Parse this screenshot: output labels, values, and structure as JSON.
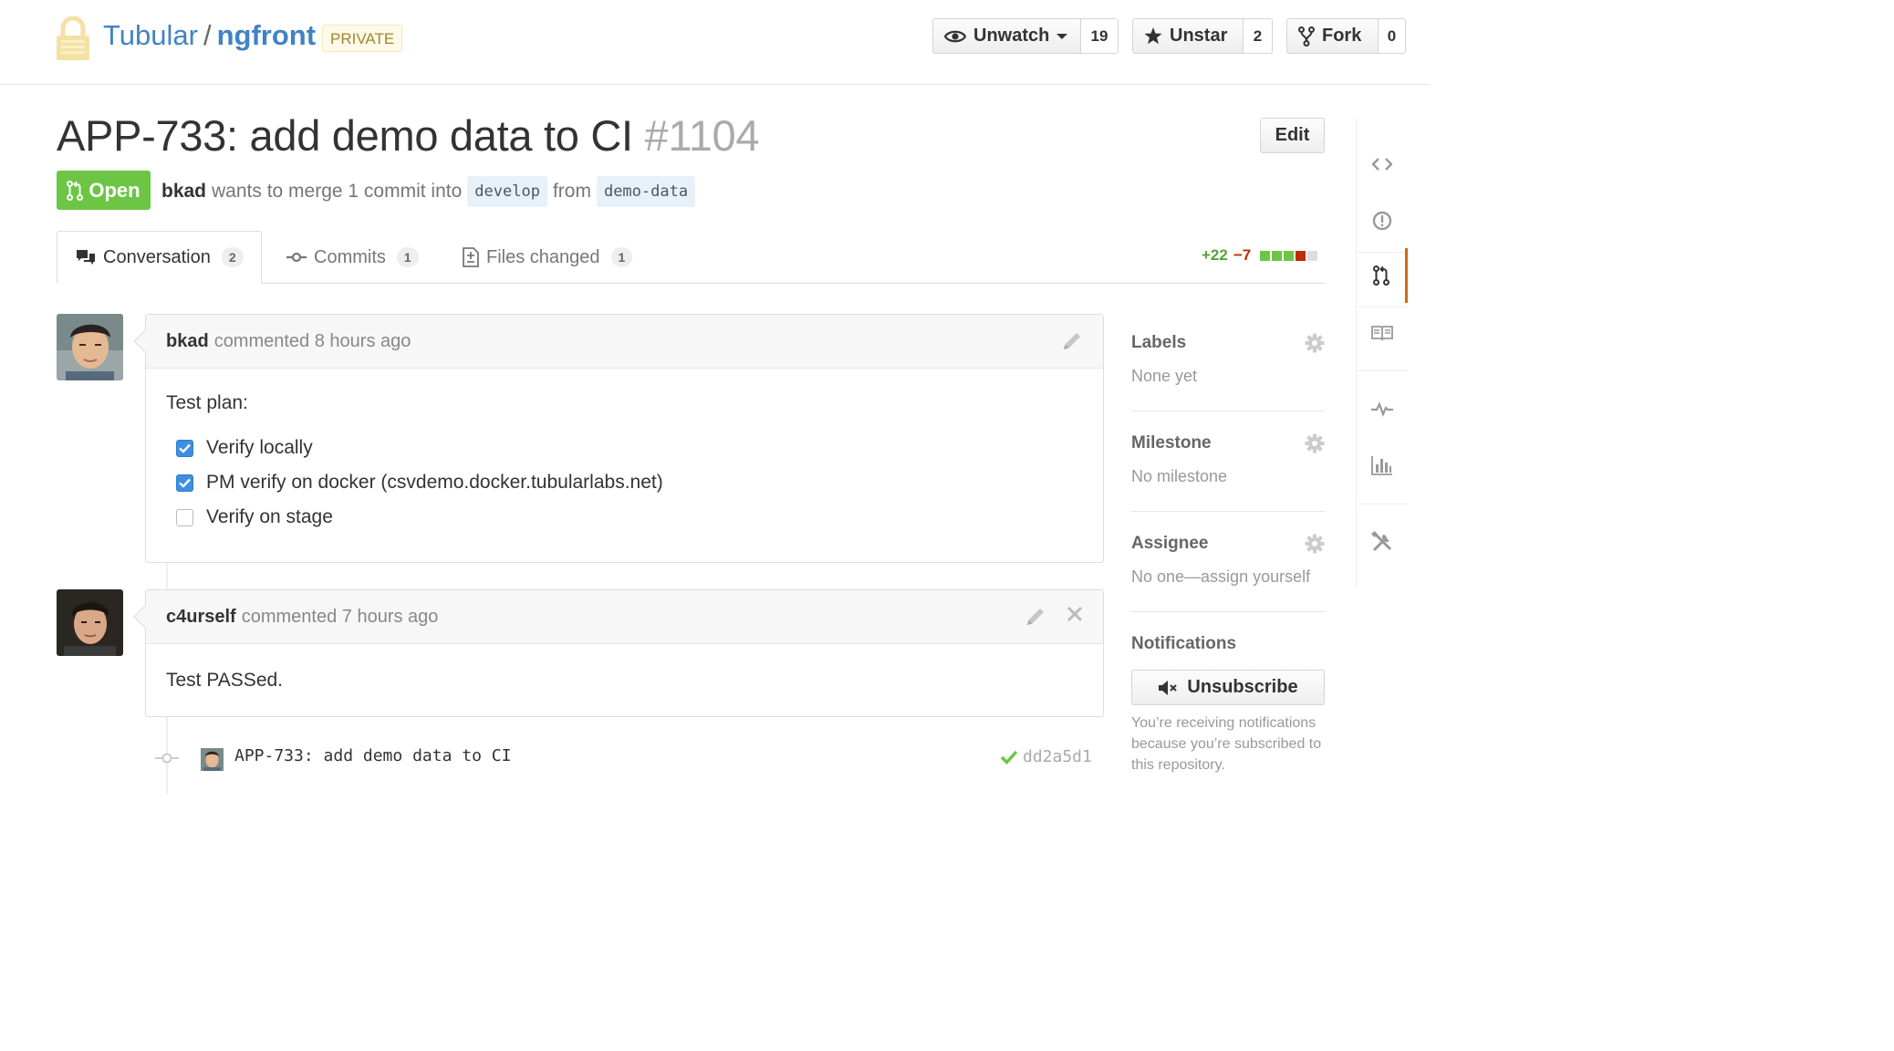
{
  "repo": {
    "owner": "Tubular",
    "separator": "/",
    "name": "ngfront",
    "visibility": "PRIVATE"
  },
  "actions": {
    "watch": {
      "label": "Unwatch",
      "count": "19"
    },
    "star": {
      "label": "Unstar",
      "count": "2"
    },
    "fork": {
      "label": "Fork",
      "count": "0"
    }
  },
  "pr": {
    "title": "APP-733: add demo data to CI",
    "number": "#1104",
    "edit_label": "Edit",
    "state": "Open",
    "author": "bkad",
    "merge_text": "wants to merge 1 commit into",
    "base_branch": "develop",
    "from_text": "from",
    "head_branch": "demo-data"
  },
  "tabs": [
    {
      "label": "Conversation",
      "count": "2"
    },
    {
      "label": "Commits",
      "count": "1"
    },
    {
      "label": "Files changed",
      "count": "1"
    }
  ],
  "diffstat": {
    "additions": "+22",
    "deletions": "−7",
    "blocks": [
      "#6cc644",
      "#6cc644",
      "#6cc644",
      "#bd2c00",
      "#dddddd"
    ]
  },
  "comments": [
    {
      "author": "bkad",
      "action": "commented 8 hours ago",
      "body_heading": "Test plan:",
      "tasks": [
        {
          "text": "Verify locally",
          "checked": true
        },
        {
          "text": "PM verify on docker (csvdemo.docker.tubularlabs.net)",
          "checked": true
        },
        {
          "text": "Verify on stage",
          "checked": false
        }
      ]
    },
    {
      "author": "c4urself",
      "action": "commented 7 hours ago",
      "body": "Test PASSed."
    }
  ],
  "commit": {
    "message": "APP-733: add demo data to CI",
    "sha": "dd2a5d1",
    "status": "success"
  },
  "sidebar": {
    "labels": {
      "heading": "Labels",
      "value": "None yet"
    },
    "milestone": {
      "heading": "Milestone",
      "value": "No milestone"
    },
    "assignee": {
      "heading": "Assignee",
      "value": "No one—assign yourself"
    },
    "notifications": {
      "heading": "Notifications",
      "button": "Unsubscribe",
      "note": "You’re receiving notifications because you’re subscribed to this repository."
    }
  },
  "colors": {
    "link": "#4183c4",
    "open_green": "#6cc644",
    "nav_active": "#d26911"
  },
  "right_nav_icons": [
    "code-icon",
    "issues-icon",
    "pull-request-icon",
    "wiki-icon",
    "pulse-icon",
    "graphs-icon",
    "settings-icon"
  ]
}
